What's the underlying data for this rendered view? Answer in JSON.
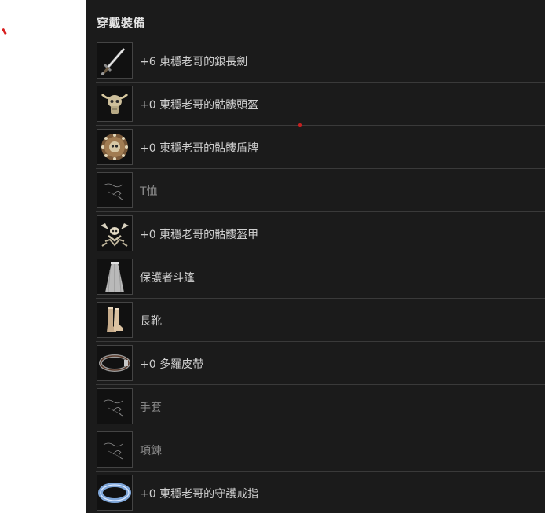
{
  "panel": {
    "title": "穿戴裝備"
  },
  "items": [
    {
      "label": "+6 東穩老哥的銀長劍",
      "icon": "sword-icon",
      "equipped": true
    },
    {
      "label": "+0 東穩老哥的骷髏頭盔",
      "icon": "skull-helmet-icon",
      "equipped": true
    },
    {
      "label": "+0 東穩老哥的骷髏盾牌",
      "icon": "skull-shield-icon",
      "equipped": true
    },
    {
      "label": "T恤",
      "icon": "empty-slot-icon",
      "equipped": false
    },
    {
      "label": "+0 東穩老哥的骷髏盔甲",
      "icon": "skull-armor-icon",
      "equipped": true
    },
    {
      "label": "保護者斗篷",
      "icon": "cloak-icon",
      "equipped": true
    },
    {
      "label": "長靴",
      "icon": "boots-icon",
      "equipped": true
    },
    {
      "label": "+0 多羅皮帶",
      "icon": "belt-icon",
      "equipped": true
    },
    {
      "label": "手套",
      "icon": "empty-slot-icon",
      "equipped": false
    },
    {
      "label": "項鍊",
      "icon": "empty-slot-icon",
      "equipped": false
    },
    {
      "label": "+0 東穩老哥的守護戒指",
      "icon": "ring-icon",
      "equipped": true
    }
  ]
}
